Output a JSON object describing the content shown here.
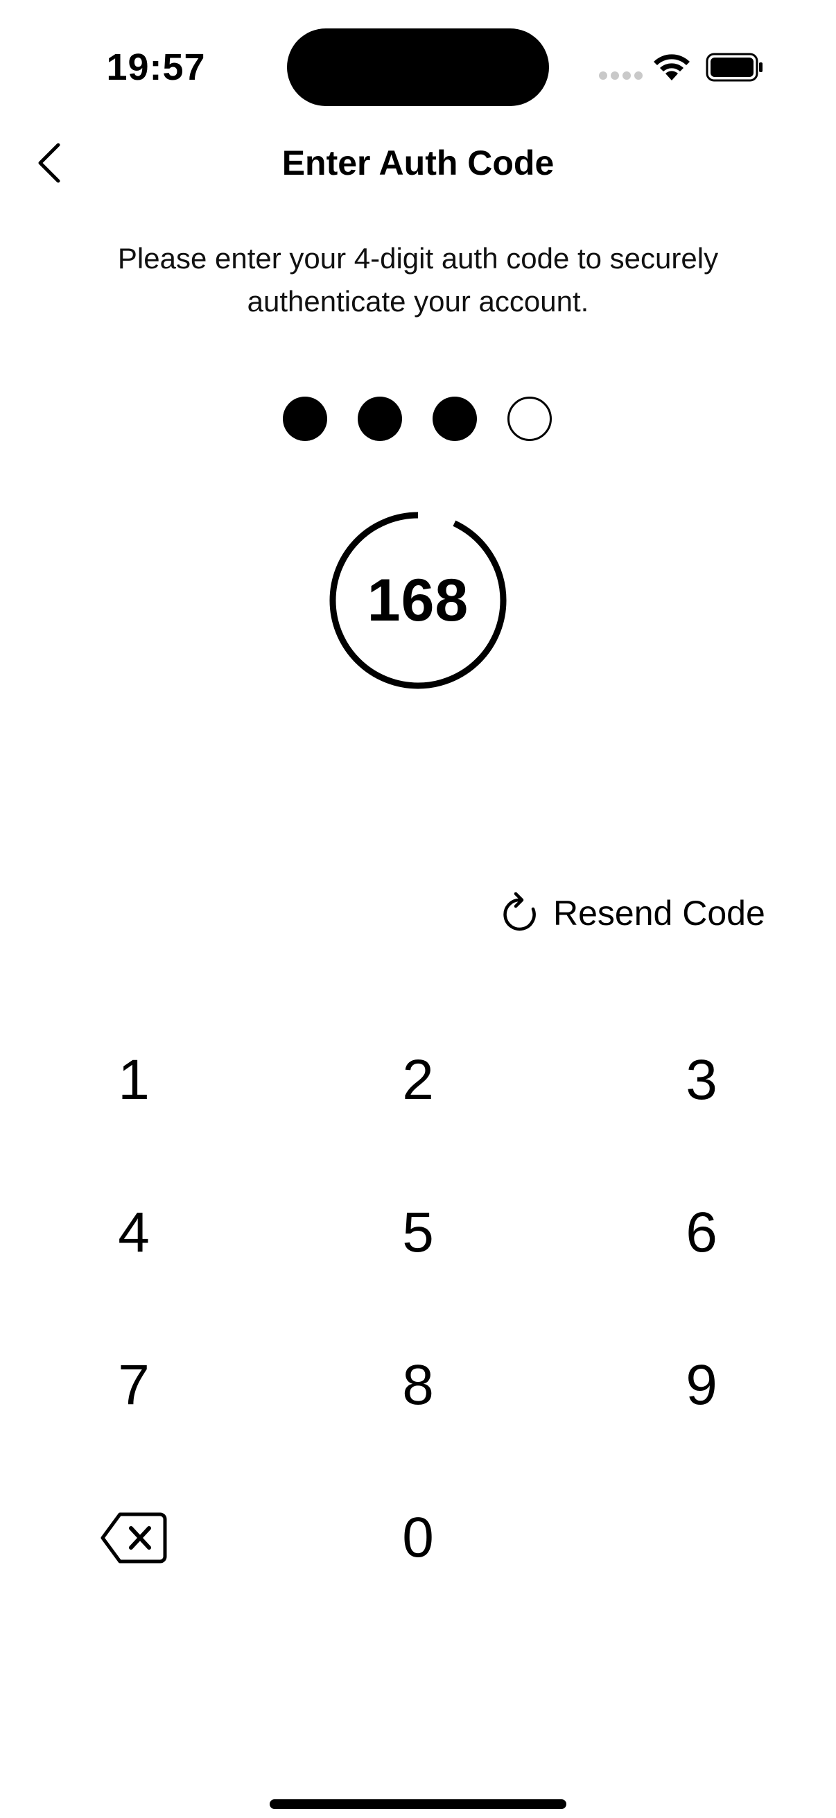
{
  "status_bar": {
    "time": "19:57"
  },
  "nav": {
    "title": "Enter Auth Code",
    "back_icon": "chevron-left-icon"
  },
  "instruction": "Please enter your 4-digit auth code to securely authenticate your account.",
  "pin": {
    "length": 4,
    "entered": 3
  },
  "timer": {
    "value": "168",
    "remaining_fraction": 0.93
  },
  "resend": {
    "label": "Resend Code",
    "icon": "refresh-icon"
  },
  "keypad": {
    "keys": [
      "1",
      "2",
      "3",
      "4",
      "5",
      "6",
      "7",
      "8",
      "9",
      "0"
    ],
    "delete_icon": "backspace-icon"
  },
  "colors": {
    "text": "#000000",
    "background": "#ffffff"
  }
}
